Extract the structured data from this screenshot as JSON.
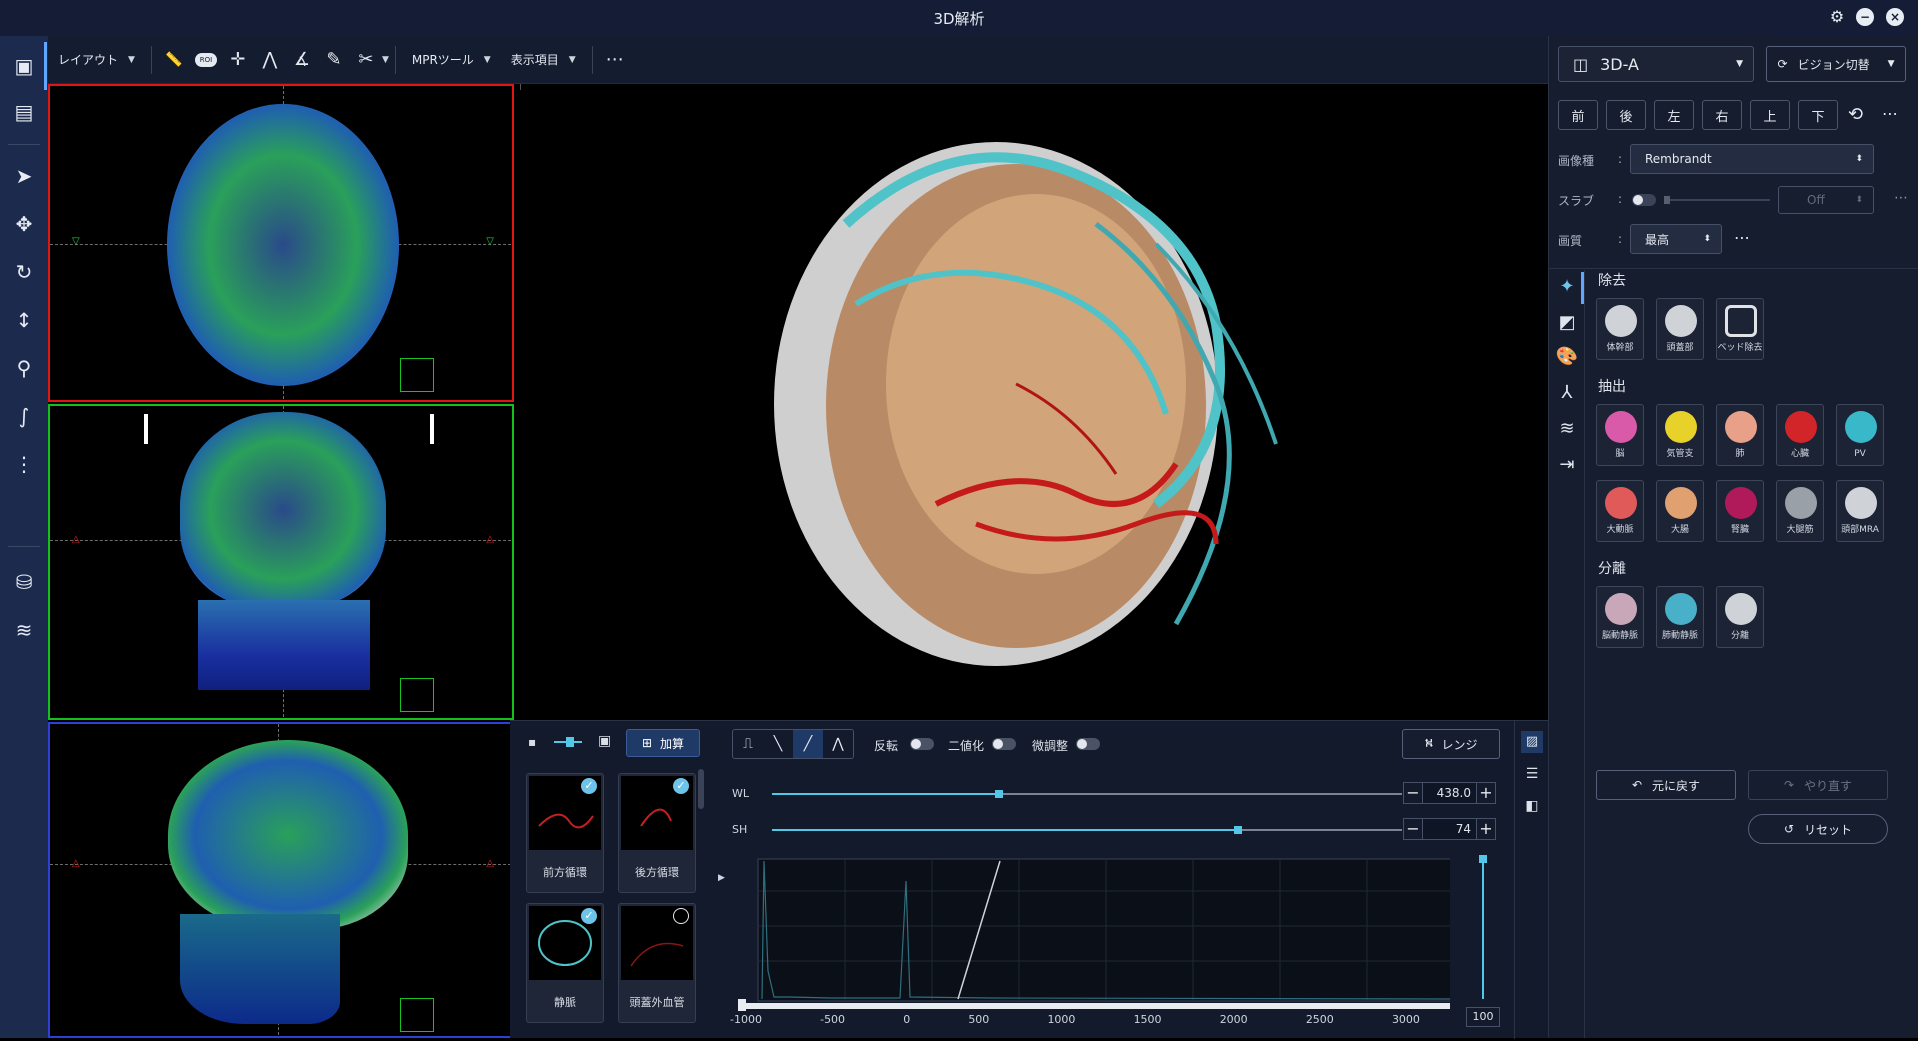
{
  "window": {
    "title": "3D解析"
  },
  "toolbar": {
    "layout_label": "レイアウト",
    "icons": [
      {
        "name": "ruler-2d-icon",
        "text": "2D"
      },
      {
        "name": "roi-icon",
        "text": "ROI"
      },
      {
        "name": "point-icon",
        "text": "POINT"
      }
    ],
    "mpr_label": "MPRツール",
    "display_label": "表示項目"
  },
  "viewports": {
    "axial_border": "#e01616",
    "coronal_border": "#12c21a",
    "sagittal_border": "#2e3fd8"
  },
  "bottom": {
    "add_label": "加算",
    "thumbnails": [
      {
        "label": "前方循環",
        "checked": true
      },
      {
        "label": "後方循環",
        "checked": true
      },
      {
        "label": "静脈",
        "checked": true
      },
      {
        "label": "頭蓋外血管",
        "checked": false
      }
    ],
    "invert_label": "反転",
    "binarize_label": "二値化",
    "fine_label": "微調整",
    "range_label": "レンジ",
    "wl_label": "WL",
    "wl_value": "438.0",
    "sh_label": "SH",
    "sh_value": "74",
    "wl_fraction": 0.36,
    "sh_fraction": 0.74,
    "histogram": {
      "x_ticks": [
        "-1000",
        "-500",
        "0",
        "500",
        "1000",
        "1500",
        "2000",
        "2500",
        "3000"
      ],
      "opacity_max_label": "100"
    }
  },
  "right": {
    "view_name": "3D-A",
    "vision_label": "ビジョン切替",
    "directions": [
      "前",
      "後",
      "左",
      "右",
      "上",
      "下"
    ],
    "image_type_label": "画像種",
    "image_type_value": "Rembrandt",
    "slab_label": "スラブ",
    "slab_value": "Off",
    "quality_label": "画質",
    "quality_value": "最高",
    "removal_title": "除去",
    "removal_items": [
      "体幹部",
      "頭蓋部",
      "ベッド除去"
    ],
    "extract_title": "抽出",
    "extract_items": [
      "脳",
      "気管支",
      "肺",
      "心臓",
      "PV",
      "大動脈",
      "大腸",
      "腎臓",
      "大腿筋",
      "頭部MRA"
    ],
    "separate_title": "分離",
    "separate_items": [
      "脳動静脈",
      "肺動静脈",
      "分離"
    ],
    "undo_label": "元に戻す",
    "redo_label": "やり直す",
    "reset_label": "リセット"
  }
}
